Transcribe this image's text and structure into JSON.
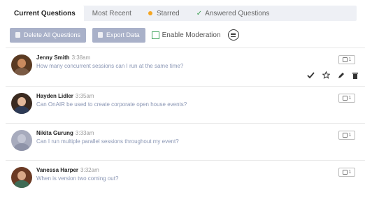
{
  "tabs": [
    {
      "label": "Current Questions",
      "active": true
    },
    {
      "label": "Most Recent",
      "active": false
    },
    {
      "label": "Starred",
      "active": false,
      "icon": "star-dot-icon"
    },
    {
      "label": "Answered Questions",
      "active": false,
      "icon": "check-icon"
    }
  ],
  "toolbar": {
    "delete_label": "Delete All Questions",
    "export_label": "Export Data",
    "moderation_label": "Enable Moderation",
    "moderation_checked": false,
    "menu_icon": "list-menu-icon"
  },
  "questions": [
    {
      "name": "Jenny Smith",
      "time": "3:38am",
      "text": "How many concurrent sessions can I run at the same time?",
      "likes": "1",
      "skin": "#c98a5e",
      "hair": "#5a3a22",
      "shirt": "#7a5a44"
    },
    {
      "name": "Hayden Lidler",
      "time": "3:35am",
      "text": "Can OnAIR be used to create corporate open house events?",
      "likes": "1",
      "skin": "#e2b89a",
      "hair": "#3a2a20",
      "shirt": "#2d3a55"
    },
    {
      "name": "Nikita Gurung",
      "time": "3:33am",
      "text": "Can I run multiple parallel sessions throughout my event?",
      "likes": "1",
      "skin": "#c3c6d4",
      "hair": "#a7abbd",
      "shirt": "#8e93a8"
    },
    {
      "name": "Vanessa Harper",
      "time": "3:32am",
      "text": "When is version two coming out?",
      "likes": "1",
      "skin": "#d9a888",
      "hair": "#6b3a24",
      "shirt": "#3f6b55"
    }
  ],
  "action_icons": [
    "checkmark-icon",
    "star-icon",
    "pencil-icon",
    "trash-icon"
  ],
  "colors": {
    "accent": "#a9b1c9",
    "check": "#3fa35b",
    "star_dot": "#f5a623",
    "question_text": "#8a96b4"
  }
}
